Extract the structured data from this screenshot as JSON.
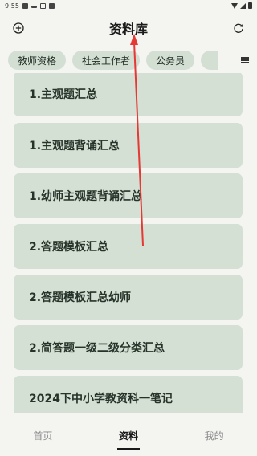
{
  "status_bar": {
    "time": "9:55"
  },
  "header": {
    "title": "资料库"
  },
  "categories": [
    "教师资格",
    "社会工作者",
    "公务员"
  ],
  "list_items": [
    "1.主观题汇总",
    "1.主观题背诵汇总",
    "1.幼师主观题背诵汇总",
    "2.答题模板汇总",
    "2.答题模板汇总幼师",
    "2.简答题一级二级分类汇总",
    "2024下中小学教资科一笔记"
  ],
  "bottom_nav": {
    "home": "首页",
    "materials": "资料",
    "mine": "我的"
  },
  "colors": {
    "accent": "#d5e0d5",
    "annotation": "#e53935"
  },
  "icons": {
    "left": "add-circle-icon",
    "right": "refresh-icon",
    "menu": "menu-icon"
  }
}
